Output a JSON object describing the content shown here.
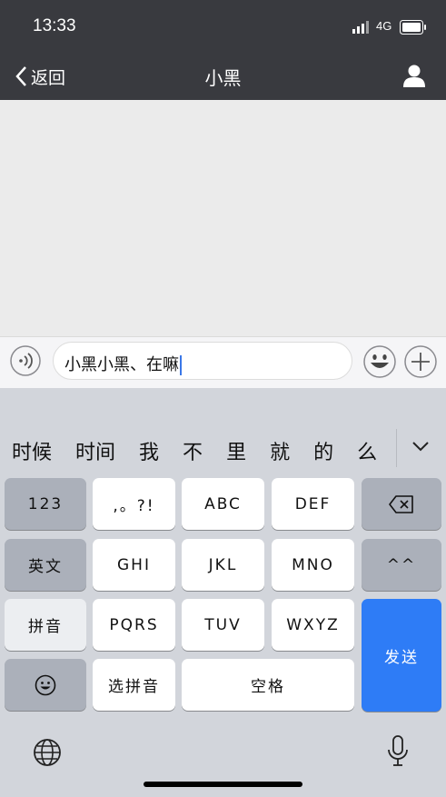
{
  "status_bar": {
    "time": "13:33",
    "network": "4G"
  },
  "nav": {
    "back_label": "返回",
    "title": "小黑"
  },
  "composer": {
    "text": "小黑小黑、在嘛"
  },
  "candidates": [
    "时候",
    "时间",
    "我",
    "不",
    "里",
    "就",
    "的",
    "么"
  ],
  "keyboard": {
    "rows": [
      [
        "123",
        ",。?!",
        "ABC",
        "DEF",
        "delete"
      ],
      [
        "英文",
        "GHI",
        "JKL",
        "MNO",
        "^^"
      ],
      [
        "拼音",
        "PQRS",
        "TUV",
        "WXYZ"
      ],
      [
        "emoji",
        "选拼音",
        "空格"
      ]
    ],
    "send_label": "发送",
    "k_123": "123",
    "k_punct": ",。?!",
    "k_abc": "ABC",
    "k_def": "DEF",
    "k_english": "英文",
    "k_ghi": "GHI",
    "k_jkl": "JKL",
    "k_mno": "MNO",
    "k_caret": "^^",
    "k_pinyin": "拼音",
    "k_pqrs": "PQRS",
    "k_tuv": "TUV",
    "k_wxyz": "WXYZ",
    "k_select_pinyin": "选拼音",
    "k_space": "空格"
  },
  "icons": [
    "signal-icon",
    "battery-icon",
    "back-chevron-icon",
    "profile-icon",
    "voice-icon",
    "emoji-icon",
    "plus-icon",
    "collapse-chevron-icon",
    "delete-icon",
    "globe-icon",
    "microphone-icon"
  ],
  "colors": {
    "nav_bg": "#393a3f",
    "chat_bg": "#ebebeb",
    "keyboard_bg": "#d2d5db",
    "send_key": "#2e7cf6",
    "caret": "#3a77e8"
  }
}
